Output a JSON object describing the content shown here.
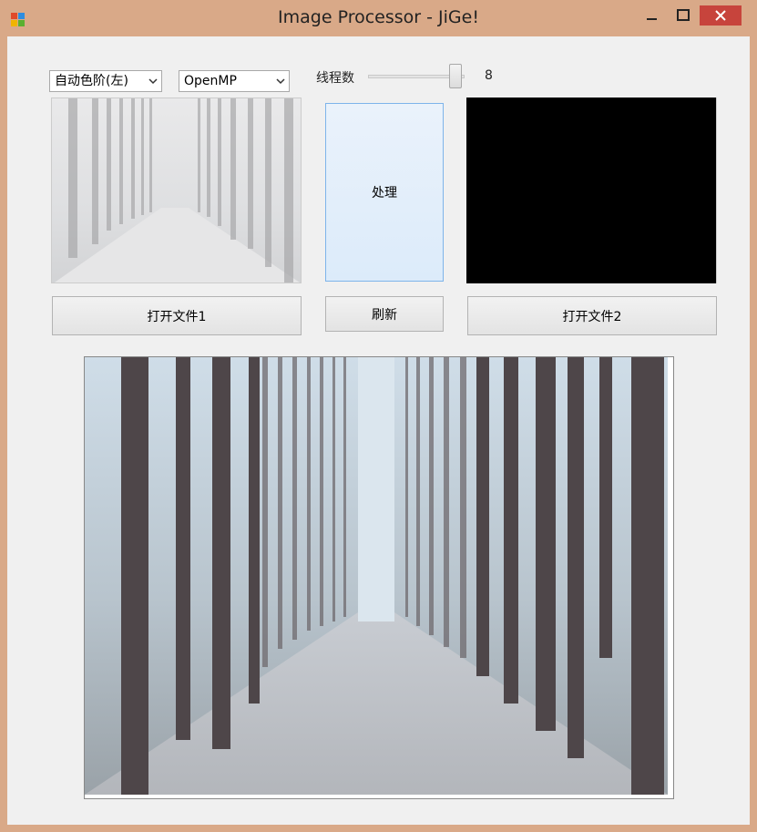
{
  "window": {
    "title": "Image Processor - JiGe!"
  },
  "controls": {
    "mode_select": {
      "value": "自动色阶(左)"
    },
    "engine_select": {
      "value": "OpenMP"
    },
    "threads_label": "线程数",
    "threads_value": "8",
    "threads_slider_level": 1.0
  },
  "buttons": {
    "process": "处理",
    "refresh": "刷新",
    "open_file_1": "打开文件1",
    "open_file_2": "打开文件2"
  },
  "icons": {
    "app": "app-icon",
    "minimize": "minimize-icon",
    "maximize": "maximize-icon",
    "close": "close-icon",
    "dropdown": "chevron-down-icon"
  },
  "colors": {
    "titlebar": "#d9a988",
    "close": "#c7443c",
    "process_button_border": "#7eb4ea",
    "output_preview": "#000000"
  }
}
